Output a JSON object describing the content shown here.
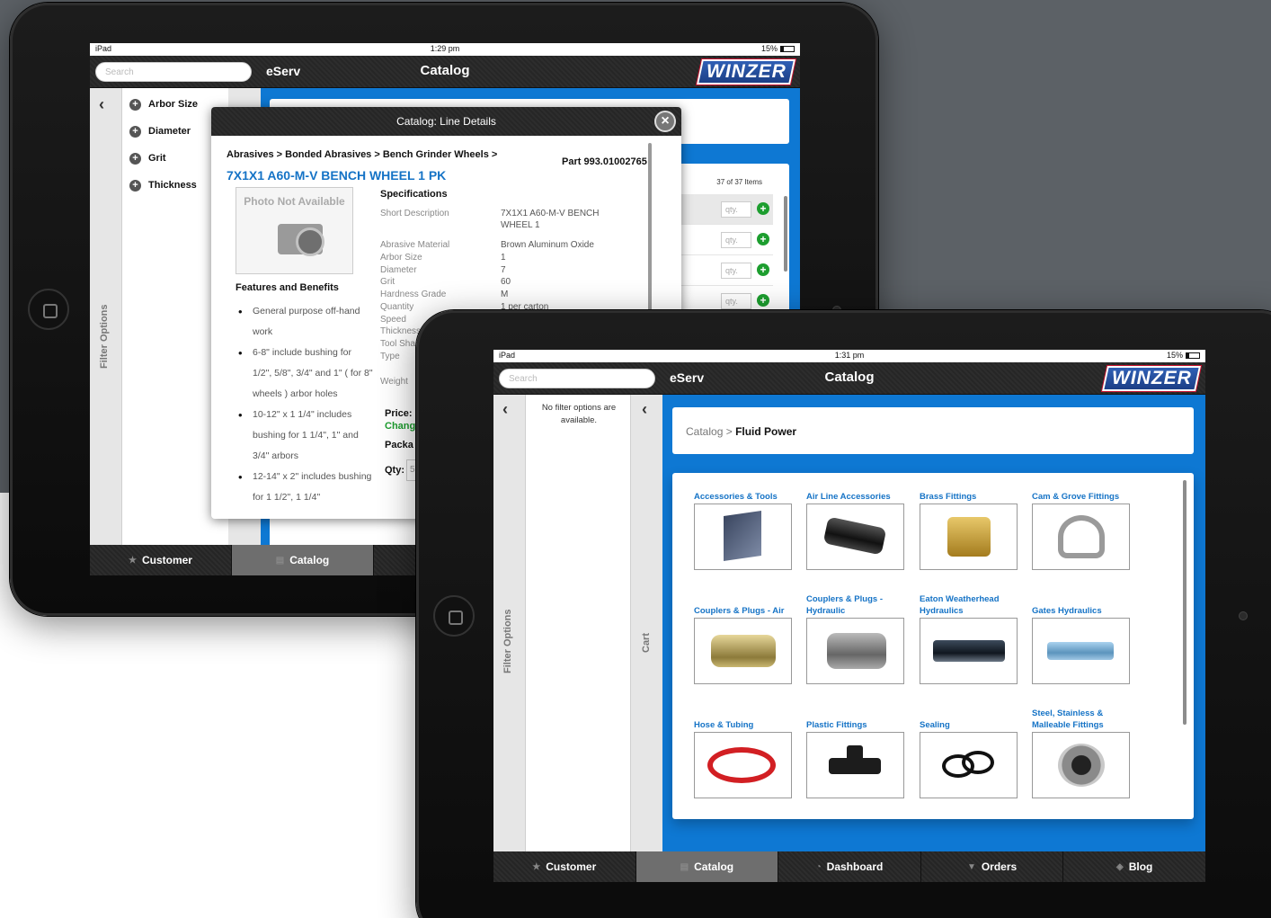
{
  "ipad1": {
    "status": {
      "carrier": "iPad",
      "time": "1:29 pm",
      "battery": "15%"
    },
    "search_placeholder": "Search",
    "app_name": "eServ",
    "title": "Catalog",
    "logo_text": "WINZER",
    "filter_label": "Filter Options",
    "filters": [
      "Arbor Size",
      "Diameter",
      "Grit",
      "Thickness"
    ],
    "items_count": "37  of 37 Items",
    "qty_placeholder": "qty.",
    "tabs": [
      "Customer",
      "Catalog",
      ""
    ],
    "modal": {
      "title": "Catalog: Line Details",
      "breadcrumb": "Abrasives > Bonded Abrasives > Bench Grinder Wheels >",
      "part": "Part 993.01002765",
      "name": "7X1X1 A60-M-V BENCH WHEEL 1 PK",
      "photo_text": "Photo Not Available",
      "features_title": "Features and Benefits",
      "features": [
        "General purpose off-hand work",
        "6-8\" include bushing for 1/2\", 5/8\", 3/4\" and 1\" ( for 8\" wheels ) arbor holes",
        "10-12\" x 1 1/4\" includes bushing for 1 1/4\", 1\" and 3/4\" arbors",
        "12-14\" x 2\" includes bushing for 1 1/2\", 1 1/4\""
      ],
      "spec_title": "Specifications",
      "specs": [
        {
          "label": "Short Description",
          "value": "7X1X1 A60-M-V BENCH"
        },
        {
          "label": "",
          "value": "WHEEL 1"
        },
        {
          "label": "Abrasive Material",
          "value": "Brown Aluminum Oxide"
        },
        {
          "label": "Arbor Size",
          "value": "1"
        },
        {
          "label": "Diameter",
          "value": "7"
        },
        {
          "label": "Grit",
          "value": "60"
        },
        {
          "label": "Hardness Grade",
          "value": "M"
        },
        {
          "label": "Quantity",
          "value": "1 per carton"
        },
        {
          "label": "Speed",
          "value": ""
        },
        {
          "label": "Thickness",
          "value": ""
        },
        {
          "label": "Tool Sha",
          "value": ""
        },
        {
          "label": "Type",
          "value": ""
        },
        {
          "label": "Weight",
          "value": ""
        }
      ],
      "price_label": "Price:",
      "change_label": "Chang",
      "package_label": "Packa",
      "qty_label": "Qty:",
      "qty_value": "5"
    }
  },
  "ipad2": {
    "status": {
      "carrier": "iPad",
      "time": "1:31 pm",
      "battery": "15%"
    },
    "search_placeholder": "Search",
    "app_name": "eServ",
    "title": "Catalog",
    "logo_text": "WINZER",
    "no_filter_text": "No filter options are available.",
    "filter_label": "Filter Options",
    "cart_label": "Cart",
    "breadcrumb_prefix": "Catalog",
    "breadcrumb_sep": " > ",
    "breadcrumb_current": "Fluid Power",
    "categories": [
      "Accessories & Tools",
      "Air Line Accessories",
      "Brass Fittings",
      "Cam & Grove Fittings",
      "Couplers & Plugs - Air",
      "Couplers & Plugs - Hydraulic",
      "Eaton Weatherhead Hydraulics",
      "Gates Hydraulics",
      "Hose & Tubing",
      "Plastic Fittings",
      "Sealing",
      "Steel, Stainless & Malleable Fittings"
    ],
    "tabs": [
      "Customer",
      "Catalog",
      "Dashboard",
      "Orders",
      "Blog"
    ],
    "active_tab": "Catalog"
  },
  "colors": {
    "accent_blue": "#0e78d3",
    "link_blue": "#1573c6",
    "add_green": "#1d9e2f",
    "nav_dark": "#2a2a2a"
  }
}
